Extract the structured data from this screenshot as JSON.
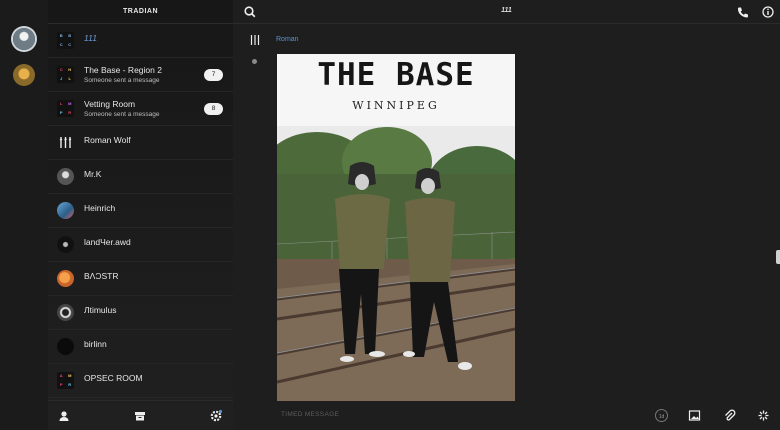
{
  "app": {
    "title": "TRADIAN"
  },
  "rail": {
    "accounts": [
      "account-1",
      "account-2"
    ]
  },
  "chats": [
    {
      "name": "111",
      "sub": "",
      "badge": "",
      "avatar_letters": [
        "B",
        "B",
        "C",
        "C"
      ],
      "accent": true
    },
    {
      "name": "The Base - Region 2",
      "sub": "Someone sent a message",
      "badge": "7",
      "avatar_letters": [
        "C",
        "H",
        "J",
        "L"
      ]
    },
    {
      "name": "Vetting Room",
      "sub": "Someone sent a message",
      "badge": "8",
      "avatar_letters": [
        "L",
        "M",
        "P",
        "R"
      ]
    },
    {
      "name": "Roman Wolf",
      "sub": "",
      "badge": ""
    },
    {
      "name": "Mr.K",
      "sub": "",
      "badge": ""
    },
    {
      "name": "Heinrich",
      "sub": "",
      "badge": ""
    },
    {
      "name": "landЧer.awd",
      "sub": "",
      "badge": ""
    },
    {
      "name": "BΛƆSTR",
      "sub": "",
      "badge": ""
    },
    {
      "name": "Лtimulus",
      "sub": "",
      "badge": ""
    },
    {
      "name": "birlinn",
      "sub": "",
      "badge": ""
    },
    {
      "name": "OPSEC ROOM",
      "sub": "",
      "badge": "",
      "avatar_letters": [
        "A",
        "M",
        "P",
        "R"
      ]
    }
  ],
  "conversation": {
    "title": "111",
    "sender": "Roman",
    "image": {
      "title": "THE BASE",
      "subtitle": "WINNIPEG"
    },
    "composer_placeholder": "TIMED MESSAGE",
    "timer_label": "1d"
  },
  "colors": {
    "accent": "#5a93cf",
    "background": "#1e1e1e",
    "panel": "#1b1b1b"
  },
  "icons": [
    "search-icon",
    "phone-icon",
    "info-icon",
    "profile-icon",
    "archive-icon",
    "settings-icon",
    "timer-icon",
    "image-icon",
    "attachment-icon",
    "sticker-icon"
  ]
}
